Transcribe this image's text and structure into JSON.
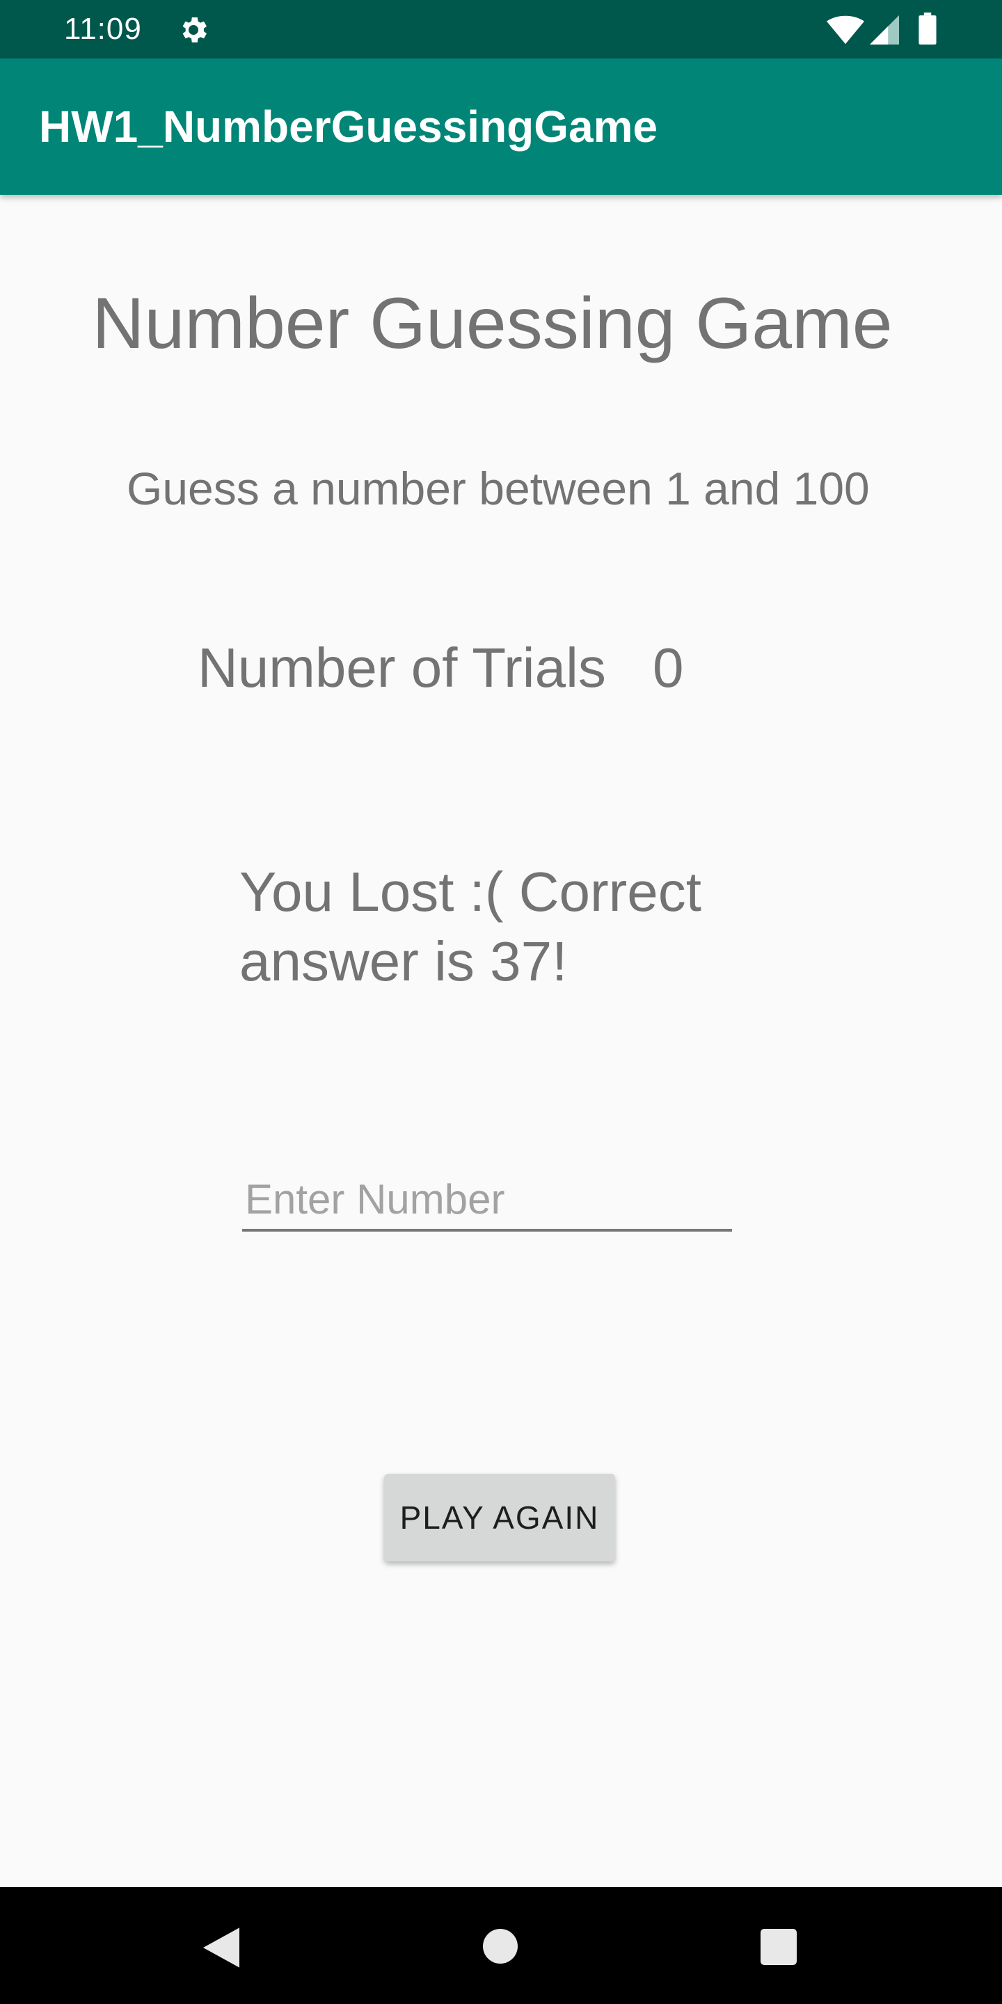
{
  "status_bar": {
    "time": "11:09",
    "icons": [
      "gear-icon",
      "wifi-icon",
      "signal-icon",
      "battery-icon"
    ]
  },
  "app_bar": {
    "title": "HW1_NumberGuessingGame",
    "color": "#008577"
  },
  "main": {
    "heading": "Number Guessing Game",
    "subheading": "Guess a number between 1 and 100",
    "trials_label": "Number of Trials",
    "trials_value": "0",
    "result_message": "You Lost :( Correct answer is 37!",
    "input": {
      "value": "",
      "placeholder": "Enter Number"
    },
    "play_again_label": "PLAY AGAIN"
  },
  "nav_bar": {
    "icons": [
      "back-icon",
      "home-icon",
      "recents-icon"
    ]
  },
  "colors": {
    "status_bar": "#00574b",
    "app_bar": "#008577",
    "background": "#fafafa",
    "text": "#737373",
    "button": "#d6d7d7"
  }
}
